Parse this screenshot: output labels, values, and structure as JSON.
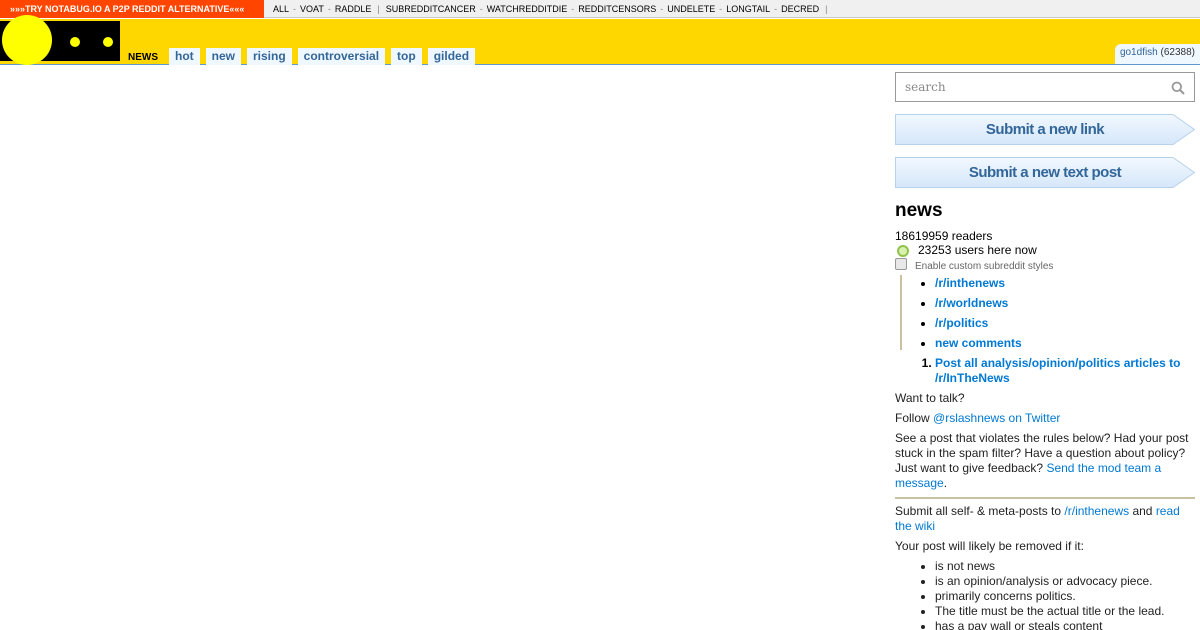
{
  "topbar": {
    "promo": "»»»TRY NOTABUG.IO A P2P REDDIT ALTERNATIVE«««",
    "group1": [
      "ALL",
      "VOAT",
      "RADDLE"
    ],
    "group2": [
      "SUBREDDITCANCER",
      "WATCHREDDITDIE",
      "REDDITCENSORS",
      "UNDELETE",
      "LONGTAIL",
      "DECRED"
    ]
  },
  "header": {
    "page_name": "NEWS",
    "tabs": [
      "hot",
      "new",
      "rising",
      "controversial",
      "top",
      "gilded"
    ],
    "username": "go1dfish",
    "karma": "(62388)"
  },
  "sidebar": {
    "search_placeholder": "search",
    "submit_link": "Submit a new link",
    "submit_text": "Submit a new text post",
    "subreddit_name": "news",
    "readers": "18619959 readers",
    "online": "23253 users here now",
    "custom_styles": "Enable custom subreddit styles",
    "nav_links": [
      "/r/inthenews",
      "/r/worldnews",
      "/r/politics",
      "new comments"
    ],
    "rule1": "Post all analysis/opinion/politics articles to /r/InTheNews",
    "want_talk": "Want to talk?",
    "follow_prefix": "Follow ",
    "follow_link": "@rslashnews on Twitter",
    "violations_text": "See a post that violates the rules below? Had your post stuck in the spam filter? Have a question about policy? Just want to give feedback? ",
    "violations_link": "Send the mod team a message",
    "violations_end": ".",
    "submit_meta_prefix": "Submit all self- & meta-posts to ",
    "submit_meta_link1": "/r/inthenews",
    "submit_meta_mid": " and ",
    "submit_meta_link2": "read the wiki",
    "removed_intro": "Your post will likely be removed if it:",
    "removal_reasons": [
      "is not news",
      "is an opinion/analysis or advocacy piece.",
      "primarily concerns politics.",
      "The title must be the actual title or the lead.",
      "has a pay wall or steals content"
    ]
  },
  "colors": {
    "header_bg": "#ffd700",
    "promo_bg": "#ff4500",
    "tab_text": "#336699",
    "link": "#0079d3"
  }
}
